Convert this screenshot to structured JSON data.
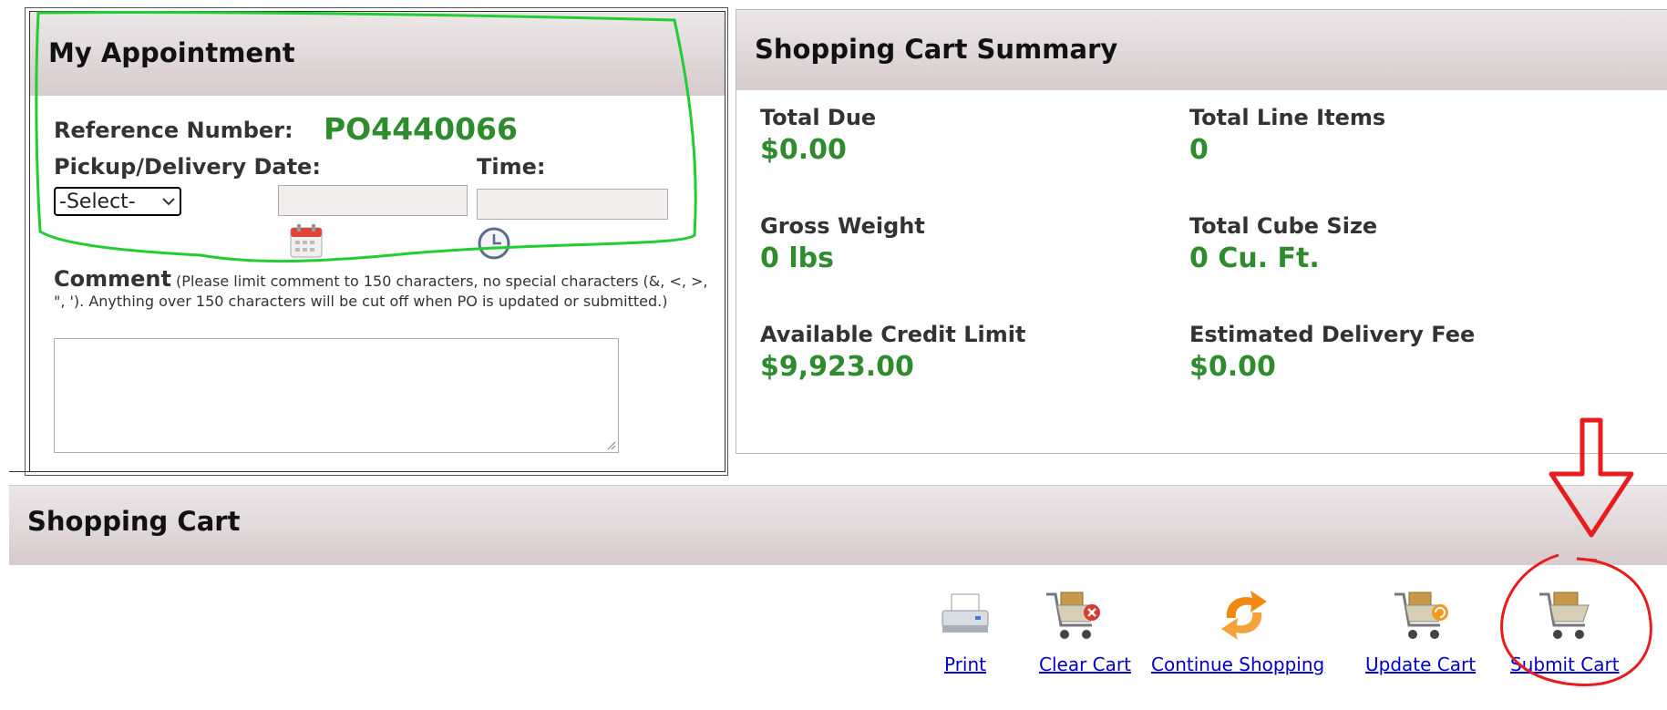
{
  "appointment": {
    "title": "My Appointment",
    "reference_label": "Reference Number:",
    "reference_value": "PO4440066",
    "date_label": "Pickup/Delivery Date:",
    "time_label": "Time:",
    "date_select_value": "-Select-",
    "comment_label": "Comment",
    "comment_note": "(Please limit comment to 150 characters, no special characters (&, <, >, \", '). Anything over 150 characters will be cut off when PO is updated or submitted.)",
    "comment_value": ""
  },
  "summary": {
    "title": "Shopping Cart Summary",
    "total_due_label": "Total Due",
    "total_due_value": "$0.00",
    "total_line_items_label": "Total Line Items",
    "total_line_items_value": "0",
    "gross_weight_label": "Gross Weight",
    "gross_weight_value": "0 lbs",
    "total_cube_label": "Total Cube Size",
    "total_cube_value": "0 Cu. Ft.",
    "credit_limit_label": "Available Credit Limit",
    "credit_limit_value": "$9,923.00",
    "delivery_fee_label": "Estimated Delivery Fee",
    "delivery_fee_value": "$0.00"
  },
  "cart": {
    "title": "Shopping Cart",
    "actions": [
      {
        "label": "Print",
        "icon": "printer-icon"
      },
      {
        "label": "Clear Cart",
        "icon": "cart-clear-icon"
      },
      {
        "label": "Continue Shopping",
        "icon": "continue-shopping-icon"
      },
      {
        "label": "Update Cart",
        "icon": "cart-update-icon"
      },
      {
        "label": "Submit Cart",
        "icon": "cart-submit-icon"
      }
    ]
  },
  "colors": {
    "value_green": "#2e8b2e",
    "link_blue": "#0000cc",
    "annotation_green": "#22cc33",
    "annotation_red": "#e81c1c"
  }
}
